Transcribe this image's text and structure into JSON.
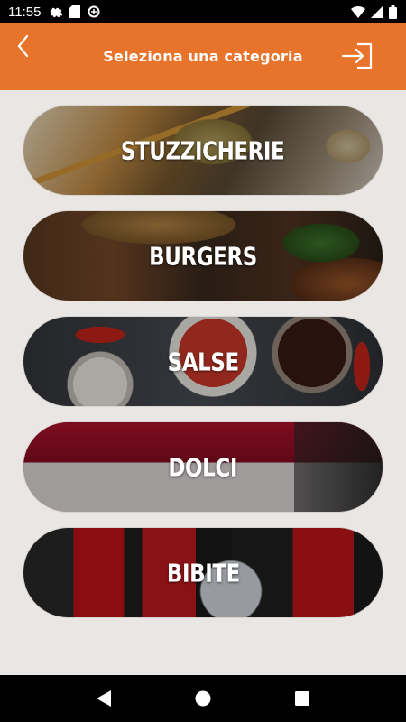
{
  "status_bar": {
    "time": "11:55",
    "left_icons": [
      "gear-icon",
      "sd-card-icon",
      "data-saver-icon"
    ],
    "right_icons": [
      "wifi-icon",
      "signal-icon",
      "battery-icon"
    ]
  },
  "app_bar": {
    "title": "Seleziona una categoria",
    "back_icon": "chevron-left-icon",
    "action_icon": "logout-icon",
    "background_color": "#e8732a"
  },
  "categories": [
    {
      "label": "STUZZICHERIE"
    },
    {
      "label": "BURGERS"
    },
    {
      "label": "SALSE"
    },
    {
      "label": "DOLCI"
    },
    {
      "label": "BIBITE"
    }
  ],
  "nav_bar": {
    "buttons": [
      "back-triangle-icon",
      "home-circle-icon",
      "recents-square-icon"
    ]
  }
}
